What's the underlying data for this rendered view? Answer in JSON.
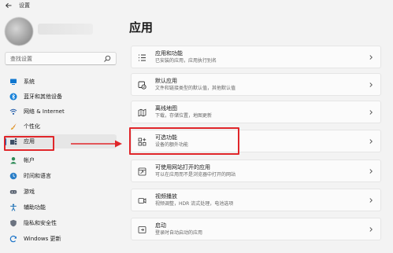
{
  "window": {
    "title": "设置"
  },
  "search": {
    "placeholder": "查找设置"
  },
  "sidebar": {
    "items": [
      {
        "label": "系统",
        "icon": "monitor-icon"
      },
      {
        "label": "蓝牙和其他设备",
        "icon": "bluetooth-icon"
      },
      {
        "label": "网络 & Internet",
        "icon": "wifi-icon"
      },
      {
        "label": "个性化",
        "icon": "brush-icon"
      },
      {
        "label": "应用",
        "icon": "apps-icon",
        "selected": true
      },
      {
        "label": "帐户",
        "icon": "person-icon"
      },
      {
        "label": "时间和语言",
        "icon": "globe-clock-icon"
      },
      {
        "label": "游戏",
        "icon": "gamepad-icon"
      },
      {
        "label": "辅助功能",
        "icon": "accessibility-icon"
      },
      {
        "label": "隐私和安全性",
        "icon": "shield-icon"
      },
      {
        "label": "Windows 更新",
        "icon": "update-icon"
      }
    ]
  },
  "main": {
    "title": "应用",
    "cards": [
      {
        "title": "应用和功能",
        "subtitle": "已安装的应用，应用执行别名",
        "icon": "list-icon"
      },
      {
        "title": "默认应用",
        "subtitle": "文件和链接类型的默认值，其他默认值",
        "icon": "default-apps-icon"
      },
      {
        "title": "离线地图",
        "subtitle": "下载，存储位置，地图更新",
        "icon": "map-icon"
      },
      {
        "title": "可选功能",
        "subtitle": "设备的额外功能",
        "icon": "grid-plus-icon",
        "highlighted": true
      },
      {
        "title": "可使用网站打开的应用",
        "subtitle": "可以在应用而不是浏览器中打开的网站",
        "icon": "web-app-icon"
      },
      {
        "title": "视频播放",
        "subtitle": "视频调整，HDR 流式处理，电池选项",
        "icon": "video-icon"
      },
      {
        "title": "启动",
        "subtitle": "登录时自动启动的应用",
        "icon": "startup-icon"
      }
    ]
  },
  "colors": {
    "accent": "#0067c0",
    "annotation": "#e0262a",
    "card_bg": "#fbfbfb",
    "page_bg": "#f3f3f3"
  }
}
